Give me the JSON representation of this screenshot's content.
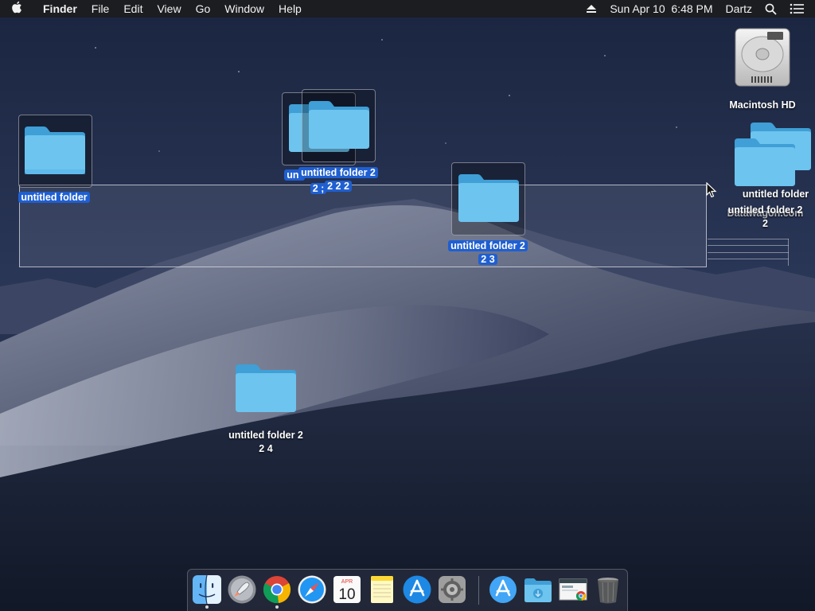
{
  "menubar": {
    "apple_icon": "apple-logo-icon",
    "app_name": "Finder",
    "menus": [
      "File",
      "Edit",
      "View",
      "Go",
      "Window",
      "Help"
    ],
    "eject_icon": "eject-icon",
    "clock": "Sun Apr 10  6:48 PM",
    "user": "Dartz",
    "spotlight_icon": "spotlight-search-icon",
    "notification_icon": "notification-center-icon"
  },
  "desktop": {
    "drive": {
      "label": "Macintosh HD",
      "icon": "hard-drive-icon"
    },
    "folders": [
      {
        "id": "f1",
        "label_line1": "untitled folder",
        "label_line2": "",
        "selected": true
      },
      {
        "id": "f2",
        "label_line1": "unt",
        "label_line2": "2 ;",
        "selected": true
      },
      {
        "id": "f3",
        "label_line1": "untitled folder 2",
        "label_line2": "2 2 2",
        "selected": true
      },
      {
        "id": "f4",
        "label_line1": "untitled folder 2",
        "label_line2": "2 3",
        "selected": true
      },
      {
        "id": "f5",
        "label_line1": "untitled folder 2",
        "label_line2": "2 4",
        "selected": false
      },
      {
        "id": "f6",
        "label_line1": "untitled folder",
        "label_line2": "",
        "selected": false
      },
      {
        "id": "f7",
        "label_line1": "untitled folder 2",
        "label_line2": "2",
        "selected": false
      }
    ],
    "obscured_label": "Datawagon.com"
  },
  "dock": {
    "items": [
      {
        "name": "Finder",
        "icon": "finder-icon",
        "running": true
      },
      {
        "name": "Launchpad",
        "icon": "launchpad-icon",
        "running": false
      },
      {
        "name": "Google Chrome",
        "icon": "chrome-icon",
        "running": true
      },
      {
        "name": "Safari",
        "icon": "safari-icon",
        "running": false
      },
      {
        "name": "Calendar",
        "icon": "calendar-icon",
        "running": false,
        "month": "APR",
        "day": "10"
      },
      {
        "name": "Notes",
        "icon": "notes-icon",
        "running": false
      },
      {
        "name": "App Store",
        "icon": "app-store-icon",
        "running": false
      },
      {
        "name": "System Preferences",
        "icon": "system-preferences-icon",
        "running": false
      },
      {
        "name": "Applications",
        "icon": "applications-stack-icon",
        "running": false
      },
      {
        "name": "Downloads",
        "icon": "downloads-folder-icon",
        "running": false
      },
      {
        "name": "Screenshot",
        "icon": "screenshot-stack-icon",
        "running": false
      },
      {
        "name": "Trash",
        "icon": "trash-icon",
        "running": false
      }
    ]
  },
  "colors": {
    "selection_highlight": "#1f5fd1",
    "folder_blue": "#6cc4ef",
    "folder_blue_dark": "#3f9fd6"
  }
}
